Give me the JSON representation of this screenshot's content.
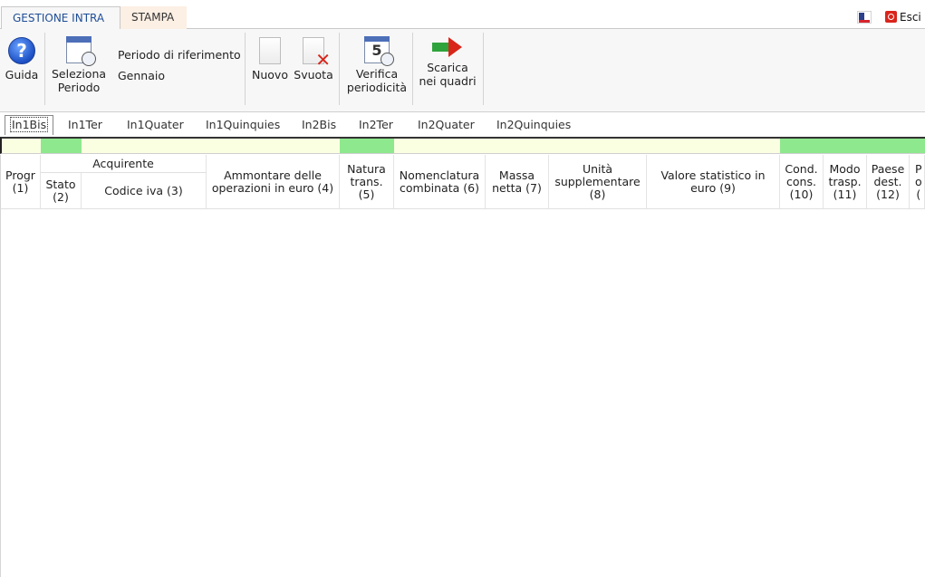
{
  "topbar": {
    "tabs": [
      {
        "label": "GESTIONE INTRA"
      },
      {
        "label": "STAMPA"
      }
    ],
    "exit_label": "Esci",
    "flag_icon": "france-flag-icon"
  },
  "ribbon": {
    "guida": {
      "label": "Guida",
      "icon": "help-icon"
    },
    "seleziona": {
      "line1": "Seleziona",
      "line2": "Periodo",
      "icon": "calendar-clock-icon"
    },
    "periodo_label": "Periodo di riferimento",
    "periodo_value": "Gennaio",
    "nuovo": {
      "label": "Nuovo",
      "icon": "new-document-icon"
    },
    "svuota": {
      "label": "Svuota",
      "icon": "clear-document-icon"
    },
    "verifica": {
      "line1": "Verifica",
      "line2": "periodicità",
      "icon": "calendar-check-icon"
    },
    "scarica": {
      "line1": "Scarica",
      "line2": "nei quadri",
      "icon": "export-arrow-icon"
    }
  },
  "subtabs": [
    "In1Bis",
    "In1Ter",
    "In1Quater",
    "In1Quinquies",
    "In2Bis",
    "In2Ter",
    "In2Quater",
    "In2Quinquies"
  ],
  "colors": {
    "accent": "#1f4e96",
    "band_yellow": "#fbffe2",
    "band_green": "#8ee88e",
    "stampa_tab": "#fcefe3"
  },
  "grid": {
    "group_header": "Acquirente",
    "columns": [
      {
        "l1": "Progr",
        "l2": "(1)",
        "l3": ""
      },
      {
        "l1": "Stato",
        "l2": "(2)",
        "l3": ""
      },
      {
        "l1": "Codice iva (3)",
        "l2": "",
        "l3": ""
      },
      {
        "l1": "Ammontare delle",
        "l2": "operazioni in euro (4)",
        "l3": ""
      },
      {
        "l1": "Natura",
        "l2": "trans.",
        "l3": "(5)"
      },
      {
        "l1": "Nomenclatura",
        "l2": "combinata (6)",
        "l3": ""
      },
      {
        "l1": "Massa",
        "l2": "netta (7)",
        "l3": ""
      },
      {
        "l1": "Unità",
        "l2": "supplementare",
        "l3": "(8)"
      },
      {
        "l1": "Valore statistico in",
        "l2": "euro (9)",
        "l3": ""
      },
      {
        "l1": "Cond.",
        "l2": "cons.",
        "l3": "(10)"
      },
      {
        "l1": "Modo",
        "l2": "trasp.",
        "l3": "(11)"
      },
      {
        "l1": "Paese",
        "l2": "dest.",
        "l3": "(12)"
      },
      {
        "l1": "P",
        "l2": "o",
        "l3": "("
      }
    ]
  }
}
